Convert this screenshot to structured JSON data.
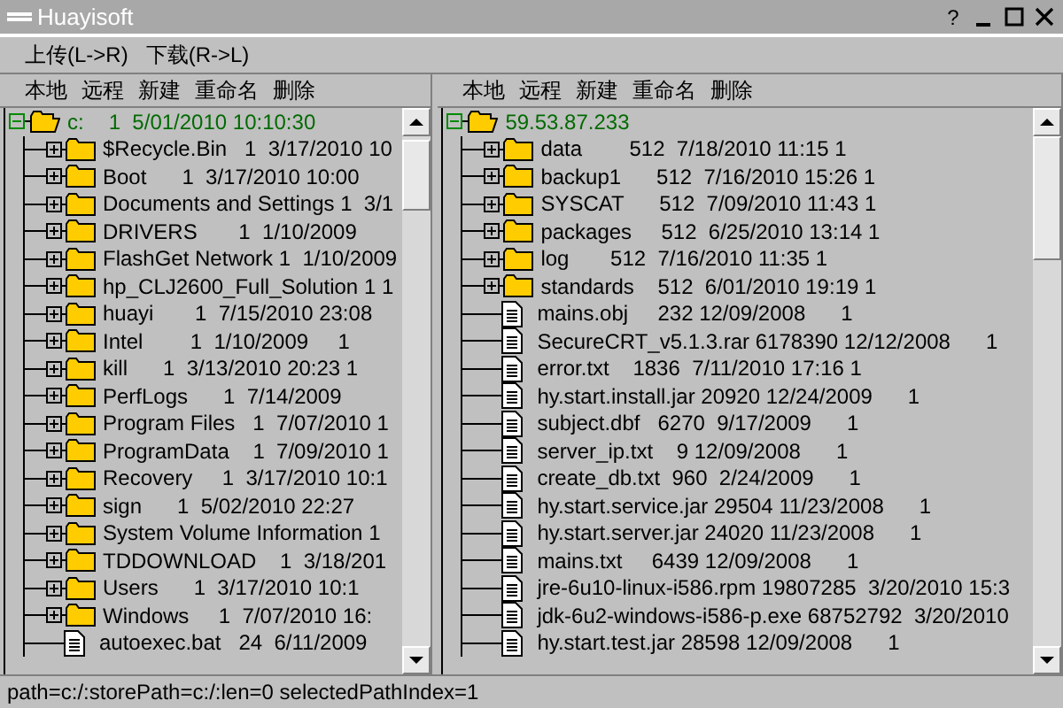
{
  "window": {
    "title": "Huayisoft",
    "help": "?"
  },
  "menu": [
    "上传(L->R)",
    "下载(R->L)"
  ],
  "panes": [
    {
      "toolbar": [
        "本地",
        "远程",
        "新建",
        "重命名",
        "删除"
      ],
      "root": {
        "label": "c:",
        "detail": "1  5/01/2010 10:10:30",
        "selected": true,
        "expanded": true,
        "children": [
          {
            "kind": "folder",
            "expanded": false,
            "text": "$Recycle.Bin   1  3/17/2010 10"
          },
          {
            "kind": "folder",
            "expanded": false,
            "text": "Boot      1  3/17/2010 10:00"
          },
          {
            "kind": "folder",
            "expanded": false,
            "text": "Documents and Settings 1  3/1"
          },
          {
            "kind": "folder",
            "expanded": false,
            "text": "DRIVERS       1  1/10/2009"
          },
          {
            "kind": "folder",
            "expanded": false,
            "text": "FlashGet Network 1  1/10/2009"
          },
          {
            "kind": "folder",
            "expanded": false,
            "text": "hp_CLJ2600_Full_Solution 1 1"
          },
          {
            "kind": "folder",
            "expanded": false,
            "text": "huayi       1  7/15/2010 23:08"
          },
          {
            "kind": "folder",
            "expanded": false,
            "text": "Intel        1  1/10/2009     1"
          },
          {
            "kind": "folder",
            "expanded": false,
            "text": "kill      1  3/13/2010 20:23 1"
          },
          {
            "kind": "folder",
            "expanded": false,
            "text": "PerfLogs      1  7/14/2009"
          },
          {
            "kind": "folder",
            "expanded": false,
            "text": "Program Files   1  7/07/2010 1"
          },
          {
            "kind": "folder",
            "expanded": false,
            "text": "ProgramData    1  7/09/2010 1"
          },
          {
            "kind": "folder",
            "expanded": false,
            "text": "Recovery     1  3/17/2010 10:1"
          },
          {
            "kind": "folder",
            "expanded": false,
            "text": "sign      1  5/02/2010 22:27"
          },
          {
            "kind": "folder",
            "expanded": false,
            "text": "System Volume Information 1"
          },
          {
            "kind": "folder",
            "expanded": false,
            "text": "TDDOWNLOAD    1  3/18/201"
          },
          {
            "kind": "folder",
            "expanded": false,
            "text": "Users      1  3/17/2010 10:1"
          },
          {
            "kind": "folder",
            "expanded": false,
            "text": "Windows     1  7/07/2010 16:"
          },
          {
            "kind": "file",
            "text": "autoexec.bat   24  6/11/2009"
          }
        ]
      }
    },
    {
      "toolbar": [
        "本地",
        "远程",
        "新建",
        "重命名",
        "删除"
      ],
      "root": {
        "label": "59.53.87.233",
        "selected": true,
        "expanded": true,
        "children": [
          {
            "kind": "folder",
            "expanded": false,
            "text": "data        512  7/18/2010 11:15 1"
          },
          {
            "kind": "folder",
            "expanded": false,
            "text": "backup1      512  7/16/2010 15:26 1"
          },
          {
            "kind": "folder",
            "expanded": false,
            "text": "SYSCAT      512  7/09/2010 11:43 1"
          },
          {
            "kind": "folder",
            "expanded": false,
            "text": "packages     512  6/25/2010 13:14 1"
          },
          {
            "kind": "folder",
            "expanded": false,
            "text": "log       512  7/16/2010 11:35 1"
          },
          {
            "kind": "folder",
            "expanded": false,
            "text": "standards    512  6/01/2010 19:19 1"
          },
          {
            "kind": "file",
            "text": "mains.obj     232 12/09/2008      1"
          },
          {
            "kind": "file",
            "text": "SecureCRT_v5.1.3.rar 6178390 12/12/2008      1"
          },
          {
            "kind": "file",
            "text": "error.txt    1836  7/11/2010 17:16 1"
          },
          {
            "kind": "file",
            "text": "hy.start.install.jar 20920 12/24/2009      1"
          },
          {
            "kind": "file",
            "text": "subject.dbf   6270  9/17/2009      1"
          },
          {
            "kind": "file",
            "text": "server_ip.txt    9 12/09/2008      1"
          },
          {
            "kind": "file",
            "text": "create_db.txt  960  2/24/2009      1"
          },
          {
            "kind": "file",
            "text": "hy.start.service.jar 29504 11/23/2008      1"
          },
          {
            "kind": "file",
            "text": "hy.start.server.jar 24020 11/23/2008      1"
          },
          {
            "kind": "file",
            "text": "mains.txt     6439 12/09/2008      1"
          },
          {
            "kind": "file",
            "text": "jre-6u10-linux-i586.rpm 19807285  3/20/2010 15:3"
          },
          {
            "kind": "file",
            "text": "jdk-6u2-windows-i586-p.exe 68752792  3/20/2010"
          },
          {
            "kind": "file",
            "text": "hy.start.test.jar 28598 12/09/2008      1"
          }
        ]
      }
    }
  ],
  "status_bar": "path=c:/:storePath=c:/:len=0 selectedPathIndex=1"
}
